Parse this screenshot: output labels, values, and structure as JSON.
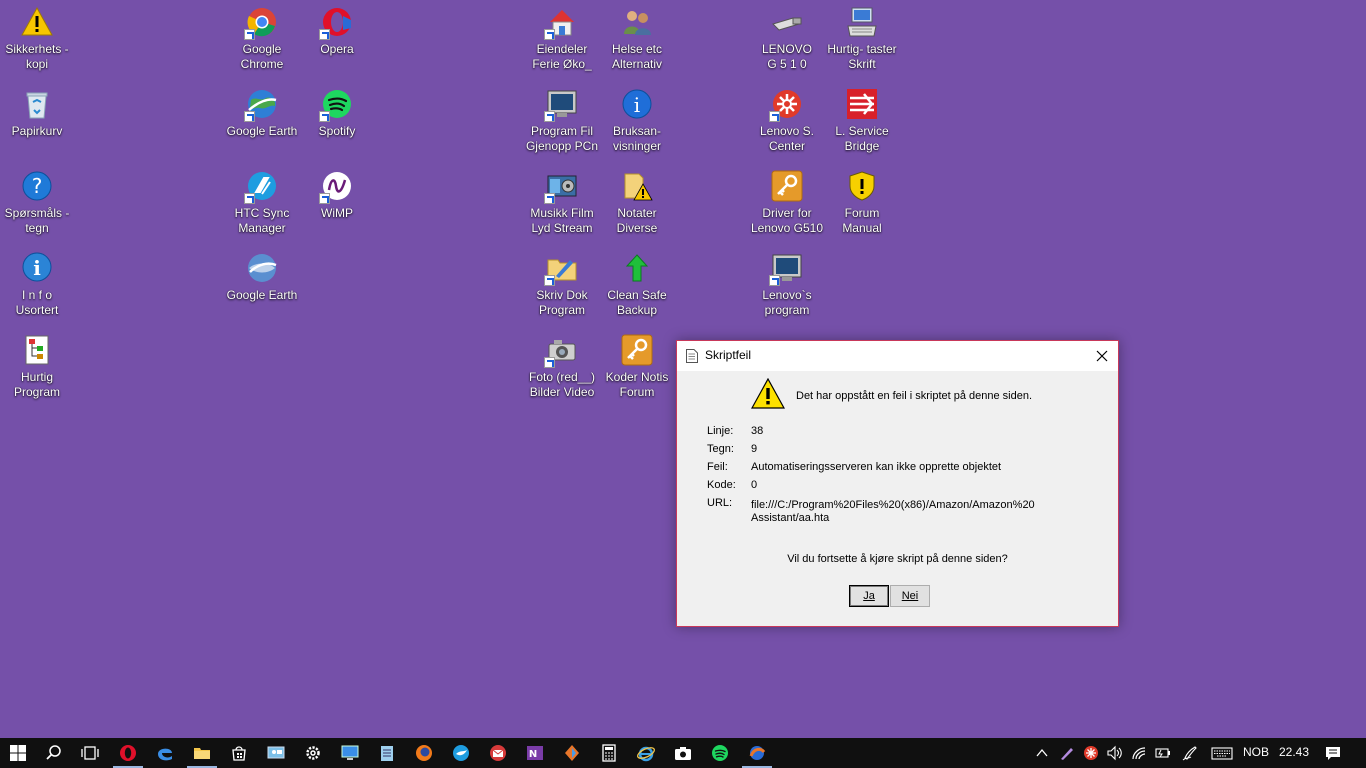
{
  "desktop": {
    "icons": [
      {
        "label": "Sikkerhets -\nkopi",
        "icon": "warning-icon"
      },
      {
        "label": "Papirkurv",
        "icon": "recycle-bin-icon"
      },
      {
        "label": "Spørsmåls -\ntegn",
        "icon": "help-icon"
      },
      {
        "label": "I n f o\nUsortert",
        "icon": "info-icon"
      },
      {
        "label": "Hurtig\nProgram",
        "icon": "tree-icon"
      },
      {
        "label": "Google\nChrome",
        "icon": "chrome-icon"
      },
      {
        "label": "Google Earth",
        "icon": "google-earth-icon"
      },
      {
        "label": "HTC Sync\nManager",
        "icon": "htc-sync-icon"
      },
      {
        "label": "Google Earth",
        "icon": "google-earth-icon"
      },
      {
        "label": "Opera",
        "icon": "opera-icon"
      },
      {
        "label": "Spotify",
        "icon": "spotify-icon"
      },
      {
        "label": "WiMP",
        "icon": "wimp-icon"
      },
      {
        "label": "Eiendeler\nFerie Øko_",
        "icon": "house-icon"
      },
      {
        "label": "Program Fil\nGjenopp PCn",
        "icon": "monitor-icon"
      },
      {
        "label": "Musikk  Film\nLyd Stream",
        "icon": "media-icon"
      },
      {
        "label": "Skriv Dok\nProgram",
        "icon": "folder-write-icon"
      },
      {
        "label": "Foto (red__)\nBilder Video",
        "icon": "camera-icon"
      },
      {
        "label": "Helse etc\nAlternativ",
        "icon": "people-icon"
      },
      {
        "label": "Bruksan-\nvisninger",
        "icon": "info-blue-icon"
      },
      {
        "label": "Notater\nDiverse",
        "icon": "notes-warning-icon"
      },
      {
        "label": "Clean Safe\nBackup",
        "icon": "green-arrow-icon"
      },
      {
        "label": "Koder Notis\nForum",
        "icon": "key-icon"
      },
      {
        "label": "LENOVO\nG 5 1 0",
        "icon": "usb-icon"
      },
      {
        "label": "Lenovo S.\nCenter",
        "icon": "lenovo-center-icon"
      },
      {
        "label": "Driver for\nLenovo G510",
        "icon": "key-icon"
      },
      {
        "label": "Lenovo`s\nprogram",
        "icon": "monitor-icon"
      },
      {
        "label": "Hurtig- taster\nSkrift",
        "icon": "keyboard-icon"
      },
      {
        "label": "L. Service\nBridge",
        "icon": "service-bridge-icon"
      },
      {
        "label": "Forum\nManual",
        "icon": "shield-warning-icon"
      }
    ]
  },
  "dialog": {
    "title": "Skriptfeil",
    "headline": "Det har oppstått en feil i skriptet på denne siden.",
    "fields": [
      {
        "label": "Linje:",
        "value": "38"
      },
      {
        "label": "Tegn:",
        "value": "9"
      },
      {
        "label": "Feil:",
        "value": "Automatiseringsserveren kan ikke opprette objektet"
      },
      {
        "label": "Kode:",
        "value": "0"
      },
      {
        "label": "URL:",
        "value": "file:///C:/Program%20Files%20(x86)/Amazon/Amazon%20Assistant/aa.hta"
      }
    ],
    "question": "Vil du fortsette å kjøre skript på denne siden?",
    "yes_label": "Ja",
    "no_label": "Nei"
  },
  "taskbar": {
    "language": "NOB",
    "time": "22.43"
  },
  "colors": {
    "desktop": "#7550a9",
    "taskbar": "#101010",
    "dialog_border": "#c8385a"
  }
}
